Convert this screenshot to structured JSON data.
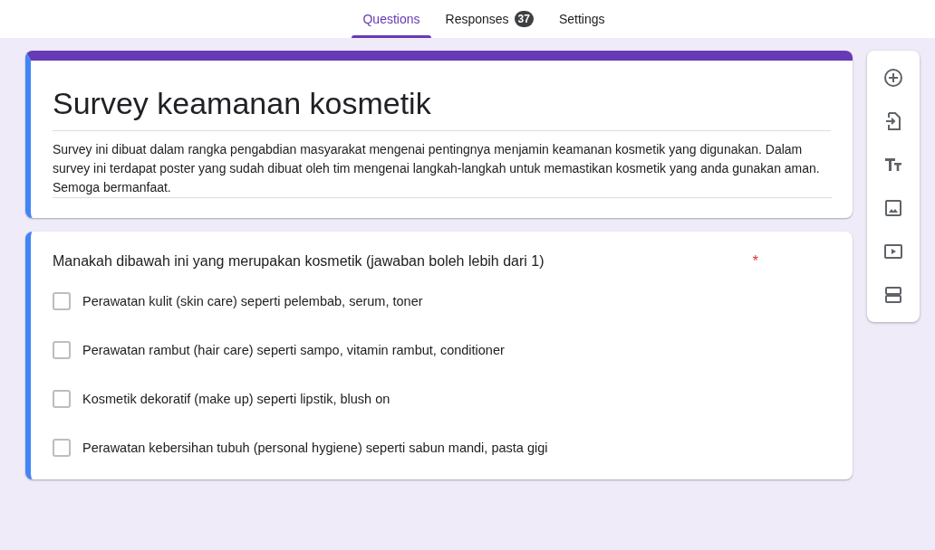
{
  "tabs": [
    {
      "label": "Questions",
      "selected": true
    },
    {
      "label": "Responses",
      "selected": false,
      "badge": "37"
    },
    {
      "label": "Settings",
      "selected": false
    }
  ],
  "form": {
    "title": "Survey keamanan kosmetik",
    "description": "Survey ini dibuat dalam rangka pengabdian masyarakat mengenai pentingnya menjamin keamanan kosmetik yang digunakan. Dalam survey ini terdapat poster yang sudah dibuat oleh tim mengenai langkah-langkah untuk memastikan kosmetik yang anda gunakan aman. Semoga bermanfaat."
  },
  "question": {
    "text": "Manakah dibawah ini yang merupakan kosmetik (jawaban boleh lebih dari 1)",
    "required_mark": "*",
    "options": [
      {
        "label": "Perawatan kulit (skin care) seperti pelembab, serum, toner",
        "checked": false
      },
      {
        "label": "Perawatan rambut (hair care) seperti sampo, vitamin rambut, conditioner",
        "checked": false
      },
      {
        "label": "Kosmetik dekoratif (make up) seperti lipstik, blush on",
        "checked": false
      },
      {
        "label": "Perawatan kebersihan tubuh (personal hygiene) seperti sabun mandi, pasta gigi",
        "checked": false
      }
    ]
  },
  "toolbar": [
    {
      "kind": "add"
    },
    {
      "kind": "import"
    },
    {
      "kind": "text"
    },
    {
      "kind": "image"
    },
    {
      "kind": "video"
    },
    {
      "kind": "section"
    }
  ]
}
